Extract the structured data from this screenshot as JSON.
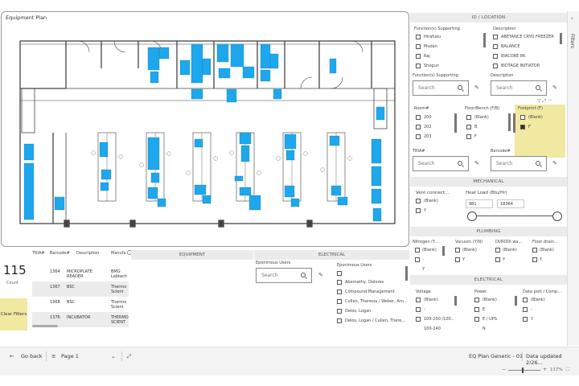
{
  "plan": {
    "title": "Equipment Plan"
  },
  "kpi": {
    "value": "115",
    "label": "Count"
  },
  "clear_filters": "Clear Filters",
  "table": {
    "headers": [
      "TRIA#",
      "Barcode#",
      "Description",
      "Manufa"
    ],
    "rows": [
      {
        "barcode": "1364",
        "description": "MICROPLATE READER",
        "manufacturer": "BMG Labtech"
      },
      {
        "barcode": "1367",
        "description": "BSC",
        "manufacturer": "Thermo Scient"
      },
      {
        "barcode": "1368",
        "description": "BSC",
        "manufacturer": "Thermo Scient"
      },
      {
        "barcode": "1376",
        "description": "INCUBATOR",
        "manufacturer": "THERMO SCIENT"
      }
    ]
  },
  "sections": {
    "equipment": "EQUIPMENT",
    "electrical_bottom": "ELECTRICAL"
  },
  "eponymous": {
    "label1": "Eponimous Users",
    "search_placeholder": "Search",
    "label2": "Eponimous Users",
    "items": [
      "",
      "Abernathy, Dolores",
      "Compound Management",
      "Cullen, Theresia / Weber, Arn...",
      "Delos, Logan",
      "Delos, Logan / Cullen, There..."
    ]
  },
  "right_panel": {
    "id_location": "ID / LOCATION",
    "func_supporting_label": "Function(s) Supporting",
    "func_supporting_items": [
      "Hirafuku",
      "Mudan",
      "Raj",
      "Shogun"
    ],
    "description_label": "Description",
    "description_items": [
      "ABEYANCE CRYO FREEZER",
      "BALANCE",
      "BIACORE 8K",
      "BIOTAGE INITIATOR"
    ],
    "func_supporting_label2": "Function(s) Supporting",
    "description_label2": "Description",
    "search_placeholder": "Search",
    "room_label": "Room#",
    "room_items": [
      "200",
      "202",
      "203"
    ],
    "floor_label": "Floor/Bench (F/B)",
    "floor_items": [
      "(Blank)",
      "B",
      "F"
    ],
    "footprint_label": "Footprint (F)",
    "footprint_items": [
      "(Blank)",
      "F"
    ],
    "tria_label": "TRIA#",
    "barcode_label": "Barcode#",
    "mechanical": "MECHANICAL",
    "vent_label": "Vent connect...",
    "vent_items": [
      "(Blank)",
      "Y"
    ],
    "heat_label": "Heat Load (Btu/Hr)",
    "heat_min": "981",
    "heat_max": "18364",
    "plumbing": "PLUMBING",
    "nitrogen_label": "Nitrogen (Y...",
    "nitrogen_items": [
      "(Blank)",
      "-",
      "Y"
    ],
    "vacuum_label": "Vacuum (Y/N)",
    "vacuum_items": [
      "(Blank)",
      "Y"
    ],
    "diro_label": "DI/RODI wa...",
    "diro_items": [
      "(Blank)",
      "Y"
    ],
    "floor_drain_label": "Floor drain...",
    "floor_drain_items": [
      "(Blank)",
      "Y"
    ],
    "electrical": "ELECTRICAL",
    "voltage_label": "Voltage",
    "voltage_items": [
      "(Blank)",
      "-",
      "100-200 /100...",
      "100-240"
    ],
    "power_label": "Power",
    "power_items": [
      "(Blank)",
      "E",
      "E / UPS",
      "N"
    ],
    "dataport_label": "Data port / Comp...",
    "dataport_items": [
      "(Blank)",
      "-",
      "Y"
    ]
  },
  "filters_label": "Filters",
  "status": {
    "back": "Go back",
    "page": "Page 1",
    "report": "EQ Plan Generic - 01",
    "updated": "Data updated 2/26...",
    "zoom": "117%"
  },
  "colors": {
    "equipment": "#1ea7ec",
    "highlight": "#f1e8a2",
    "header": "#ebebeb"
  }
}
